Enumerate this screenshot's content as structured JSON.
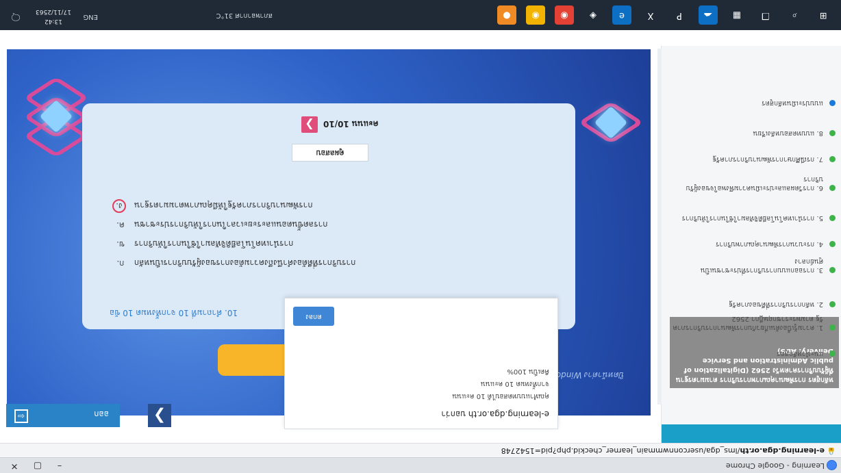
{
  "browser": {
    "title": "Learning - Google Chrome",
    "url_domain": "e-learning.dga.or.th",
    "url_path": "/lms_dga/userconnwmmain_learner_checkid.php?pid=1542748",
    "win_min": "–",
    "win_max": "▢",
    "win_close": "✕"
  },
  "sidebar": {
    "course_title": "หลักสูตร การพัฒนาคุณภาพการบริการ ตามมาตรฐานที่ผู้รับบริการคาดหวัง 2562 (Digitalization of public Administration and Service Delivery: ADS)",
    "lessons": [
      {
        "label": "แนะนำหลักสูตร",
        "color": "#3cb449"
      },
      {
        "label": "1. ความรู้เบื้องต้นเกี่ยวกับการพัฒนาการบริการภาครัฐ ตามพระราชกฤษฎีกา 2562",
        "color": "#3cb449"
      },
      {
        "label": "2. หลักการบริการที่ดีของภาครัฐ",
        "color": "#3cb449"
      },
      {
        "label": "3. การออกแบบการบริการที่ประชาชนเป็นศูนย์กลาง",
        "color": "#3cb449"
      },
      {
        "label": "4. กระบวนการพัฒนาคุณภาพบริการ",
        "color": "#3cb449"
      },
      {
        "label": "5. การนำเทคโนโลยีดิจิทัลมาใช้ในการให้บริการ",
        "color": "#3cb449"
      },
      {
        "label": "6. การวัดผลและประเมินความพึงพอใจของผู้รับบริการ",
        "color": "#3cb449"
      },
      {
        "label": "7. กรณีศึกษาการพัฒนาบริการภาครัฐ",
        "color": "#3cb449"
      },
      {
        "label": "8. แบบทดสอบหลังเรียน",
        "color": "#3cb449"
      },
      {
        "label": "แบบประเมินหลักสูตร",
        "color": "#1a7ad9"
      }
    ]
  },
  "slide": {
    "window_label": "ปิดหน้าต่าง Windows",
    "question": "10. คำถามที่ 10 จากทั้งหมด 10 ข้อ",
    "options": [
      {
        "mark": "ก.",
        "text": "การบริการที่ดีต้องคำนึงถึงความต้องการของผู้รับบริการเป็นหลัก",
        "selected": false
      },
      {
        "mark": "ข.",
        "text": "การนำเทคโนโลยีดิจิทัลมาใช้ในการให้บริการ",
        "selected": false
      },
      {
        "mark": "ค.",
        "text": "การลดขั้นตอนและระยะเวลาในการให้บริการประชาชน",
        "selected": false
      },
      {
        "mark": "ง.",
        "text": "การพัฒนาบริการภาครัฐให้มีคุณภาพตามมาตรฐาน",
        "selected": true
      }
    ],
    "result_button": "ดูผลสอบ",
    "score_label": "คะแนน 10/10",
    "score_chevron": "❯"
  },
  "popup": {
    "site": "e-learning.dga.or.th บอกว่า",
    "lines": [
      "คุณทำแบบทดสอบได้ 10 คะแนน",
      "จากทั้งหมด 10 คะแนน",
      "คิดเป็น 100%"
    ],
    "ok_button": "ตกลง"
  },
  "nav": {
    "next_glyph": "❯",
    "exit_label": "ออก",
    "exit_glyph": "⇦"
  },
  "taskbar": {
    "time": "13:42",
    "date": "17/11/2563",
    "lang": "ENG",
    "notification_text": "สภาพอากาศ 31°C",
    "icons": [
      {
        "name": "start",
        "glyph": "⊞",
        "bg": "transparent"
      },
      {
        "name": "search",
        "glyph": "⌕",
        "bg": "transparent"
      },
      {
        "name": "task-view",
        "glyph": "❐",
        "bg": "transparent"
      },
      {
        "name": "calculator",
        "glyph": "▦",
        "bg": "transparent"
      },
      {
        "name": "onedrive",
        "glyph": "☁",
        "bg": "#0d6fc4"
      },
      {
        "name": "powerpoint",
        "glyph": "P",
        "bg": "transparent"
      },
      {
        "name": "excel",
        "glyph": "X",
        "bg": "transparent"
      },
      {
        "name": "edge",
        "glyph": "e",
        "bg": "#0d6fc4"
      },
      {
        "name": "store",
        "glyph": "◈",
        "bg": "transparent"
      },
      {
        "name": "chrome-a",
        "glyph": "◉",
        "bg": "#e34133"
      },
      {
        "name": "chrome-b",
        "glyph": "◉",
        "bg": "#f2b200"
      },
      {
        "name": "line",
        "glyph": "●",
        "bg": "#f08a24"
      }
    ]
  }
}
